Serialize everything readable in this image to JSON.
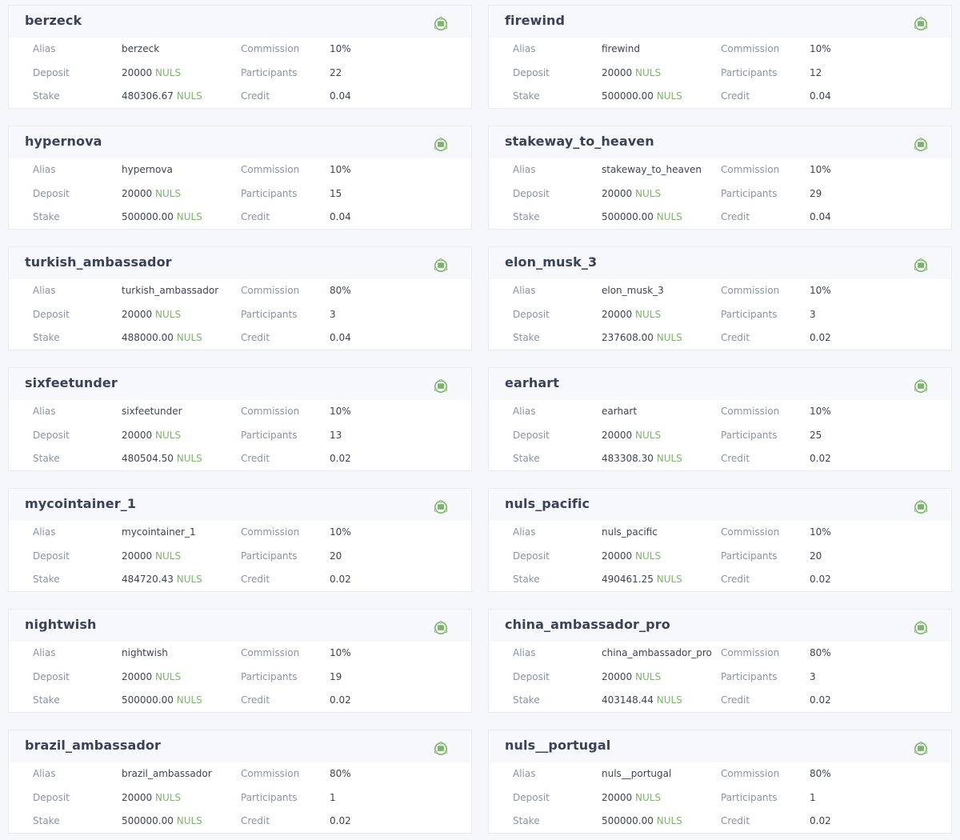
{
  "labels": {
    "alias": "Alias",
    "deposit": "Deposit",
    "stake": "Stake",
    "commission": "Commission",
    "participants": "Participants",
    "credit": "Credit",
    "unit": "NULS"
  },
  "colors": {
    "accent_green": "#7db46c",
    "title": "#3a4257",
    "label": "#8a93a6",
    "value": "#3d4456"
  },
  "status_icon": "consensus-node-icon",
  "nodes": [
    {
      "name": "berzeck",
      "alias": "berzeck",
      "deposit": "20000",
      "stake": "480306.67",
      "commission": "10%",
      "participants": "22",
      "credit": "0.04"
    },
    {
      "name": "firewind",
      "alias": "firewind",
      "deposit": "20000",
      "stake": "500000.00",
      "commission": "10%",
      "participants": "12",
      "credit": "0.04"
    },
    {
      "name": "hypernova",
      "alias": "hypernova",
      "deposit": "20000",
      "stake": "500000.00",
      "commission": "10%",
      "participants": "15",
      "credit": "0.04"
    },
    {
      "name": "stakeway_to_heaven",
      "alias": "stakeway_to_heaven",
      "deposit": "20000",
      "stake": "500000.00",
      "commission": "10%",
      "participants": "29",
      "credit": "0.04"
    },
    {
      "name": "turkish_ambassador",
      "alias": "turkish_ambassador",
      "deposit": "20000",
      "stake": "488000.00",
      "commission": "80%",
      "participants": "3",
      "credit": "0.04"
    },
    {
      "name": "elon_musk_3",
      "alias": "elon_musk_3",
      "deposit": "20000",
      "stake": "237608.00",
      "commission": "10%",
      "participants": "3",
      "credit": "0.02"
    },
    {
      "name": "sixfeetunder",
      "alias": "sixfeetunder",
      "deposit": "20000",
      "stake": "480504.50",
      "commission": "10%",
      "participants": "13",
      "credit": "0.02"
    },
    {
      "name": "earhart",
      "alias": "earhart",
      "deposit": "20000",
      "stake": "483308.30",
      "commission": "10%",
      "participants": "25",
      "credit": "0.02"
    },
    {
      "name": "mycointainer_1",
      "alias": "mycointainer_1",
      "deposit": "20000",
      "stake": "484720.43",
      "commission": "10%",
      "participants": "20",
      "credit": "0.02"
    },
    {
      "name": "nuls_pacific",
      "alias": "nuls_pacific",
      "deposit": "20000",
      "stake": "490461.25",
      "commission": "10%",
      "participants": "20",
      "credit": "0.02"
    },
    {
      "name": "nightwish",
      "alias": "nightwish",
      "deposit": "20000",
      "stake": "500000.00",
      "commission": "10%",
      "participants": "19",
      "credit": "0.02"
    },
    {
      "name": "china_ambassador_pro",
      "alias": "china_ambassador_pro",
      "deposit": "20000",
      "stake": "403148.44",
      "commission": "80%",
      "participants": "3",
      "credit": "0.02"
    },
    {
      "name": "brazil_ambassador",
      "alias": "brazil_ambassador",
      "deposit": "20000",
      "stake": "500000.00",
      "commission": "80%",
      "participants": "1",
      "credit": "0.02"
    },
    {
      "name": "nuls__portugal",
      "alias": "nuls__portugal",
      "deposit": "20000",
      "stake": "500000.00",
      "commission": "80%",
      "participants": "1",
      "credit": "0.02"
    }
  ]
}
